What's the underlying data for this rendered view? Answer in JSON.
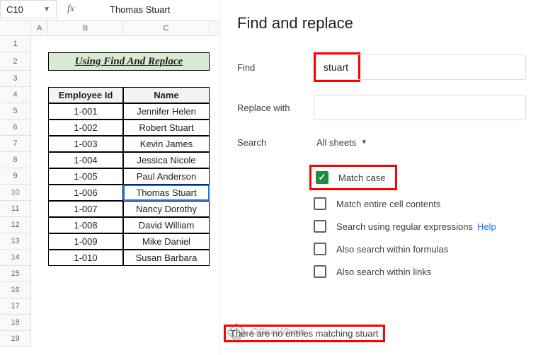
{
  "namebox": {
    "ref": "C10"
  },
  "fx": {
    "label": "fx",
    "value": "Thomas Stuart"
  },
  "cols": {
    "a": "A",
    "b": "B",
    "c": "C"
  },
  "rows": [
    "1",
    "2",
    "3",
    "4",
    "5",
    "6",
    "7",
    "8",
    "9",
    "10",
    "11",
    "12",
    "13",
    "14",
    "15",
    "16",
    "17",
    "18",
    "19"
  ],
  "title": "Using Find And Replace",
  "headers": {
    "id": "Employee Id",
    "name": "Name"
  },
  "data": [
    {
      "id": "1-001",
      "name": "Jennifer Helen"
    },
    {
      "id": "1-002",
      "name": "Robert Stuart"
    },
    {
      "id": "1-003",
      "name": "Kevin James"
    },
    {
      "id": "1-004",
      "name": "Jessica Nicole"
    },
    {
      "id": "1-005",
      "name": "Paul Anderson"
    },
    {
      "id": "1-006",
      "name": "Thomas Stuart"
    },
    {
      "id": "1-007",
      "name": "Nancy Dorothy"
    },
    {
      "id": "1-008",
      "name": "David William"
    },
    {
      "id": "1-009",
      "name": "Mike Daniel"
    },
    {
      "id": "1-010",
      "name": "Susan Barbara"
    }
  ],
  "dialog": {
    "title": "Find and replace",
    "find_label": "Find",
    "find_value": "stuart",
    "replace_label": "Replace with",
    "replace_value": "",
    "search_label": "Search",
    "search_scope": "All sheets",
    "opt_match_case": "Match case",
    "opt_entire": "Match entire cell contents",
    "opt_regex": "Search using regular expressions",
    "help": "Help",
    "opt_formulas": "Also search within formulas",
    "opt_links": "Also search within links",
    "status": "There are no entries matching stuart"
  },
  "watermark": "OfficeWheel"
}
